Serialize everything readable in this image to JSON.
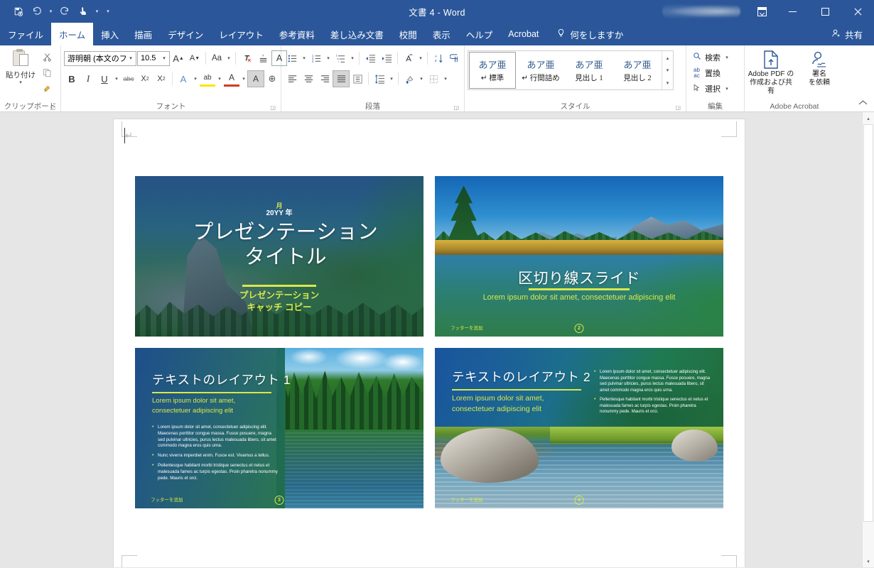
{
  "window": {
    "title": "文書 4  -  Word",
    "quick_access": [
      {
        "name": "save",
        "glyph": "💾"
      },
      {
        "name": "undo",
        "glyph": "↶"
      },
      {
        "name": "redo",
        "glyph": "↻"
      },
      {
        "name": "touch-mouse-mode",
        "glyph": "☝"
      },
      {
        "name": "customize-quick-access-toolbar",
        "glyph": "☰"
      }
    ],
    "ribbon_display_options": "リボンの表示オプション",
    "minimize": "最小化",
    "maximize": "最大化",
    "close": "閉じる"
  },
  "tabs": [
    {
      "label": "ファイル",
      "active": false
    },
    {
      "label": "ホーム",
      "active": true
    },
    {
      "label": "挿入",
      "active": false
    },
    {
      "label": "描画",
      "active": false
    },
    {
      "label": "デザイン",
      "active": false
    },
    {
      "label": "レイアウト",
      "active": false
    },
    {
      "label": "参考資料",
      "active": false
    },
    {
      "label": "差し込み文書",
      "active": false
    },
    {
      "label": "校閲",
      "active": false
    },
    {
      "label": "表示",
      "active": false
    },
    {
      "label": "ヘルプ",
      "active": false
    },
    {
      "label": "Acrobat",
      "active": false
    }
  ],
  "tell_me": "何をしますか",
  "share": "共有",
  "ribbon": {
    "clipboard": {
      "label": "クリップボード",
      "paste": "貼り付け",
      "cut": "切り取り",
      "copy": "コピー",
      "format_painter": "書式のコピー/貼り付け"
    },
    "font": {
      "label": "フォント",
      "font_name": "游明朝 (本文のフ",
      "font_size": "10.5",
      "grow_font": "A",
      "shrink_font": "A",
      "change_case": "Aa",
      "clear_formatting": "書式のクリア",
      "phonetic_guide": "ルビ",
      "enclose_character": "A",
      "bold": "B",
      "italic": "I",
      "underline": "U",
      "strikethrough": "abc",
      "subscript": "X",
      "superscript": "X",
      "text_effects": "A",
      "text_highlight": "ab",
      "font_color": "A",
      "character_shading": "A",
      "enclose_chars": "⊕"
    },
    "paragraph": {
      "label": "段落",
      "bullets": "箇条書き",
      "numbering": "段落番号",
      "multilevel_list": "アウトライン",
      "decrease_indent": "インデントを減らす",
      "increase_indent": "インデントを増やす",
      "sort": "並べ替え",
      "phonetic_sort": "ふりがな",
      "show_marks": "編集記号の表示/非表示",
      "align_left": "左揃え",
      "align_center": "中央揃え",
      "align_right": "右揃え",
      "justify": "両端揃え",
      "distribute": "均等割り付け",
      "line_spacing": "行と段落の間隔",
      "shading": "塗りつぶし",
      "borders": "罫線"
    },
    "styles": {
      "label": "スタイル",
      "items": [
        {
          "preview": "あア亜",
          "name": "↵ 標準",
          "selected": true
        },
        {
          "preview": "あア亜",
          "name": "↵ 行間詰め",
          "selected": false
        },
        {
          "preview": "あア亜",
          "name": "見出し 1",
          "selected": false
        },
        {
          "preview": "あア亜",
          "name": "見出し 2",
          "selected": false
        }
      ]
    },
    "editing": {
      "label": "編集",
      "find": "検索",
      "replace": "置換",
      "select": "選択"
    },
    "acrobat": {
      "label": "Adobe Acrobat",
      "create_share_pdf": "Adobe PDF の\n作成および共有",
      "create_share_pdf_line1": "Adobe PDF の",
      "create_share_pdf_line2": "作成および共有",
      "request_signature_line1": "署名",
      "request_signature_line2": "を依頼"
    },
    "collapse": "リボンを折りたたむ"
  },
  "document": {
    "slides": [
      {
        "id": 1,
        "month": "月",
        "year": "20YY 年",
        "title_line1": "プレゼンテーション",
        "title_line2": "タイトル",
        "subtitle_line1": "プレゼンテーション",
        "subtitle_line2": "キャッチ コピー",
        "accent_color": "#d9e84a"
      },
      {
        "id": 2,
        "title": "区切り線スライド",
        "subtitle": "Lorem ipsum dolor sit amet, consectetuer adipiscing elit",
        "footer": "フッターを追加",
        "page_number": "2",
        "accent_color": "#d9e84a"
      },
      {
        "id": 3,
        "title": "テキストのレイアウト 1",
        "subtitle_line1": "Lorem ipsum dolor sit amet,",
        "subtitle_line2": "consectetuer adipiscing elit",
        "bullets": [
          "Lorem ipsum dolor sit amet, consectetuer adipiscing elit. Maecenas porttitor congue massa. Fusce posuere, magna sed pulvinar ultricies, purus lectus malesuada libero, sit amet commodo magna eros quis urna.",
          "Nunc viverra imperdiet enim. Fusce est. Vivamus a tellus.",
          "Pellentesque habitant morbi tristique senectus et netus et malesuada fames ac turpis egestas. Proin pharetra nonummy pede. Mauris et orci."
        ],
        "footer": "フッターを追加",
        "page_number": "3",
        "accent_color": "#d9e84a"
      },
      {
        "id": 4,
        "title": "テキストのレイアウト 2",
        "subtitle_line1": "Lorem ipsum dolor sit amet,",
        "subtitle_line2": "consectetuer adipiscing elit",
        "bullets": [
          "Lorem ipsum dolor sit amet, consectetuer adipiscing elit. Maecenas porttitor congue massa. Fusce posuere, magna sed pulvinar ultricies, purus lectus malesuada libero, sit amet commodo magna eros quis urna.",
          "Pellentesque habitant morbi tristique senectus et netus et malesuada fames ac turpis egestas. Proin pharetra nonummy pede. Mauris et orci."
        ],
        "footer": "フッターを追加",
        "page_number": "4",
        "accent_color": "#d9e84a"
      }
    ],
    "paragraph_mark": "↵"
  },
  "colors": {
    "titlebar": "#2b579a",
    "ribbon_bg": "#ffffff",
    "workspace": "#e6e6e6",
    "accent_green_yellow": "#d9e84a"
  }
}
